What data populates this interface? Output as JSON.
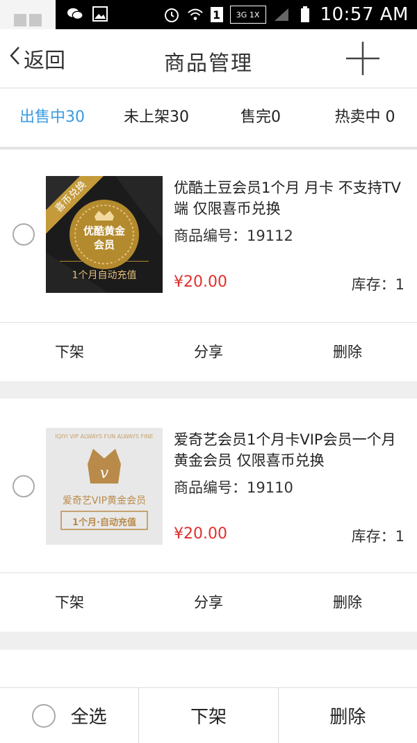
{
  "status_bar": {
    "time": "10:57 AM",
    "network_label": "3G 1X",
    "sim_label": "1"
  },
  "header": {
    "back_label": "返回",
    "title": "商品管理"
  },
  "tabs": [
    {
      "label": "出售中30",
      "active": true
    },
    {
      "label": "未上架30",
      "active": false
    },
    {
      "label": "售完0",
      "active": false
    },
    {
      "label": "热卖中 0",
      "active": false
    }
  ],
  "products": [
    {
      "name": "优酷土豆会员1个月  月卡  不支持TV端   仅限喜币兑换",
      "code": "商品编号：19112",
      "price": "¥20.00",
      "stock": "库存：1",
      "thumb": {
        "ribbon": "喜币兑换",
        "badge_line1": "优酷黄金",
        "badge_line2": "会员",
        "footer": "1个月自动充值"
      }
    },
    {
      "name": "爱奇艺会员1个月卡VIP会员一个月黄金会员   仅限喜币兑换",
      "code": "商品编号：19110",
      "price": "¥20.00",
      "stock": "库存：1",
      "thumb": {
        "arc_text": "IQIYI VIP ALWAYS FUN ALWAYS FINE",
        "title": "爱奇艺VIP黄金会员",
        "footer": "1个月·自动充值"
      }
    }
  ],
  "card_actions": [
    "下架",
    "分享",
    "删除"
  ],
  "bottom_bar": {
    "select_all": "全选",
    "unlist": "下架",
    "delete": "删除"
  },
  "colors": {
    "accent": "#3a9be0",
    "price": "#e0302b"
  }
}
